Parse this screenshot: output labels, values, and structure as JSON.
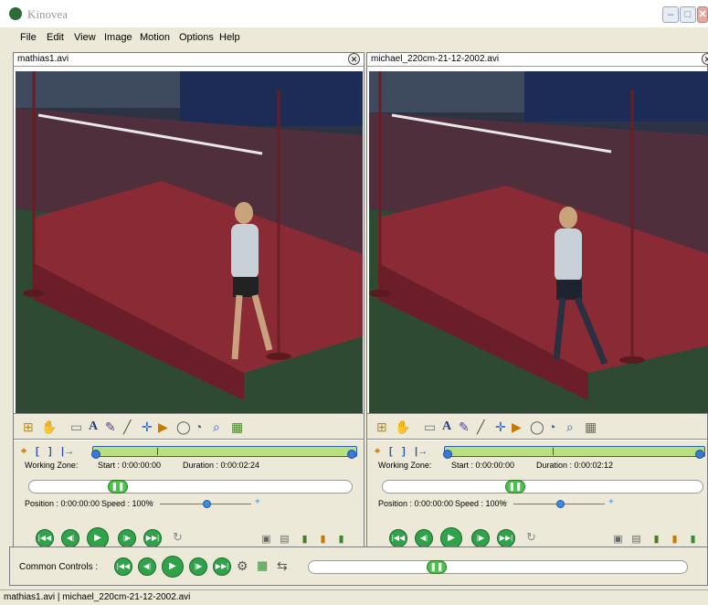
{
  "app": {
    "title": "Kinovea"
  },
  "window_buttons": {
    "minimize": "–",
    "maximize": "□",
    "close": "✕"
  },
  "menu": [
    "File",
    "Edit",
    "View",
    "Image",
    "Motion",
    "Options",
    "Help"
  ],
  "panes": [
    {
      "file": "mathias1.avi",
      "working_zone_label": "Working Zone:",
      "start": "Start : 0:00:00:00",
      "duration": "Duration : 0:00:02:24",
      "position": "Position : 0:00:00:00",
      "speed": "Speed : 100%",
      "position_fraction": 0.26
    },
    {
      "file": "michael_220cm-21-12-2002.avi",
      "working_zone_label": "Working Zone:",
      "start": "Start : 0:00:00:00",
      "duration": "Duration : 0:00:02:12",
      "position": "Position : 0:00:00:00",
      "speed": "Speed : 100%",
      "position_fraction": 0.41
    }
  ],
  "common": {
    "label": "Common Controls :",
    "position_fraction": 0.33
  },
  "status": "mathias1.avi | michael_220cm-21-12-2002.avi",
  "colors": {
    "accent_green": "#2fa24a",
    "zone_green": "#b9e07f",
    "zone_blue": "#3a79d8",
    "mat_red": "#8a2a35"
  },
  "icons": {
    "toolbar": [
      "add-keyframe-icon",
      "hand-icon",
      "eraser-icon",
      "text-icon",
      "pencil-icon",
      "line-icon",
      "cross-icon",
      "angle-icon",
      "circle-icon",
      "chrono-icon",
      "magnifier-icon",
      "grid-icon"
    ],
    "playback": [
      "first-frame-icon",
      "previous-frame-icon",
      "play-icon",
      "next-frame-icon",
      "last-frame-icon",
      "loop-icon"
    ],
    "export": [
      "snapshot-icon",
      "sequence-icon",
      "save-icon",
      "export-icon",
      "paint-icon"
    ]
  }
}
